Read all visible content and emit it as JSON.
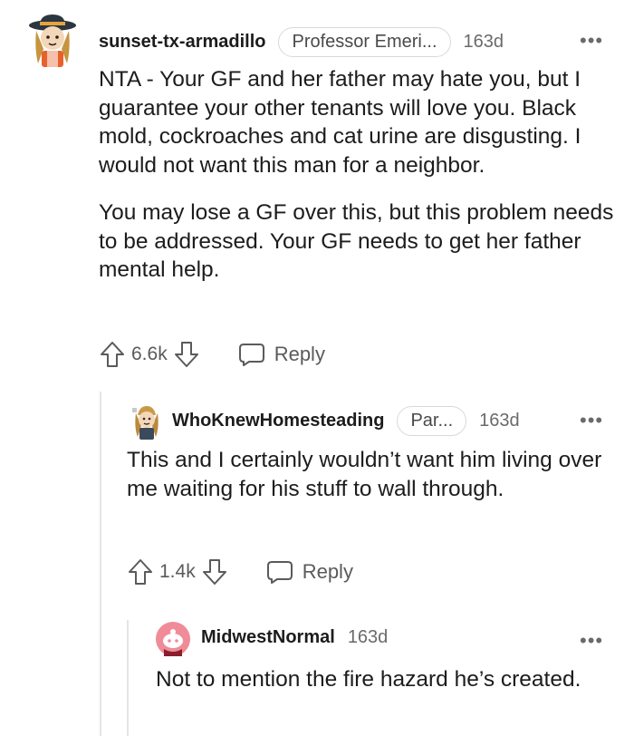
{
  "comments": [
    {
      "username": "sunset-tx-armadillo",
      "flair": "Professor Emeri...",
      "age": "163d",
      "body": [
        "NTA - Your GF and her father may hate you, but I guarantee your other tenants will love you. Black mold, cockroaches and cat urine are disgusting. I would not want this man for a neighbor.",
        "You may lose a GF over this, but this problem needs to be addressed. Your GF needs to get her father mental help."
      ],
      "votes": "6.6k",
      "reply_label": "Reply"
    },
    {
      "username": "WhoKnewHomesteading",
      "flair": "Par...",
      "age": "163d",
      "body": [
        "This and I certainly wouldn’t want him living over me waiting for his stuff to wall through."
      ],
      "votes": "1.4k",
      "reply_label": "Reply"
    },
    {
      "username": "MidwestNormal",
      "age": "163d",
      "body": [
        "Not to mention the fire hazard he’s created."
      ]
    }
  ],
  "more_glyph": "•••",
  "colors": {
    "text": "#1c1c1c",
    "muted": "#6a6a6a",
    "thread_line": "#e5e5e5",
    "avatar_pink": "#f08b98"
  }
}
